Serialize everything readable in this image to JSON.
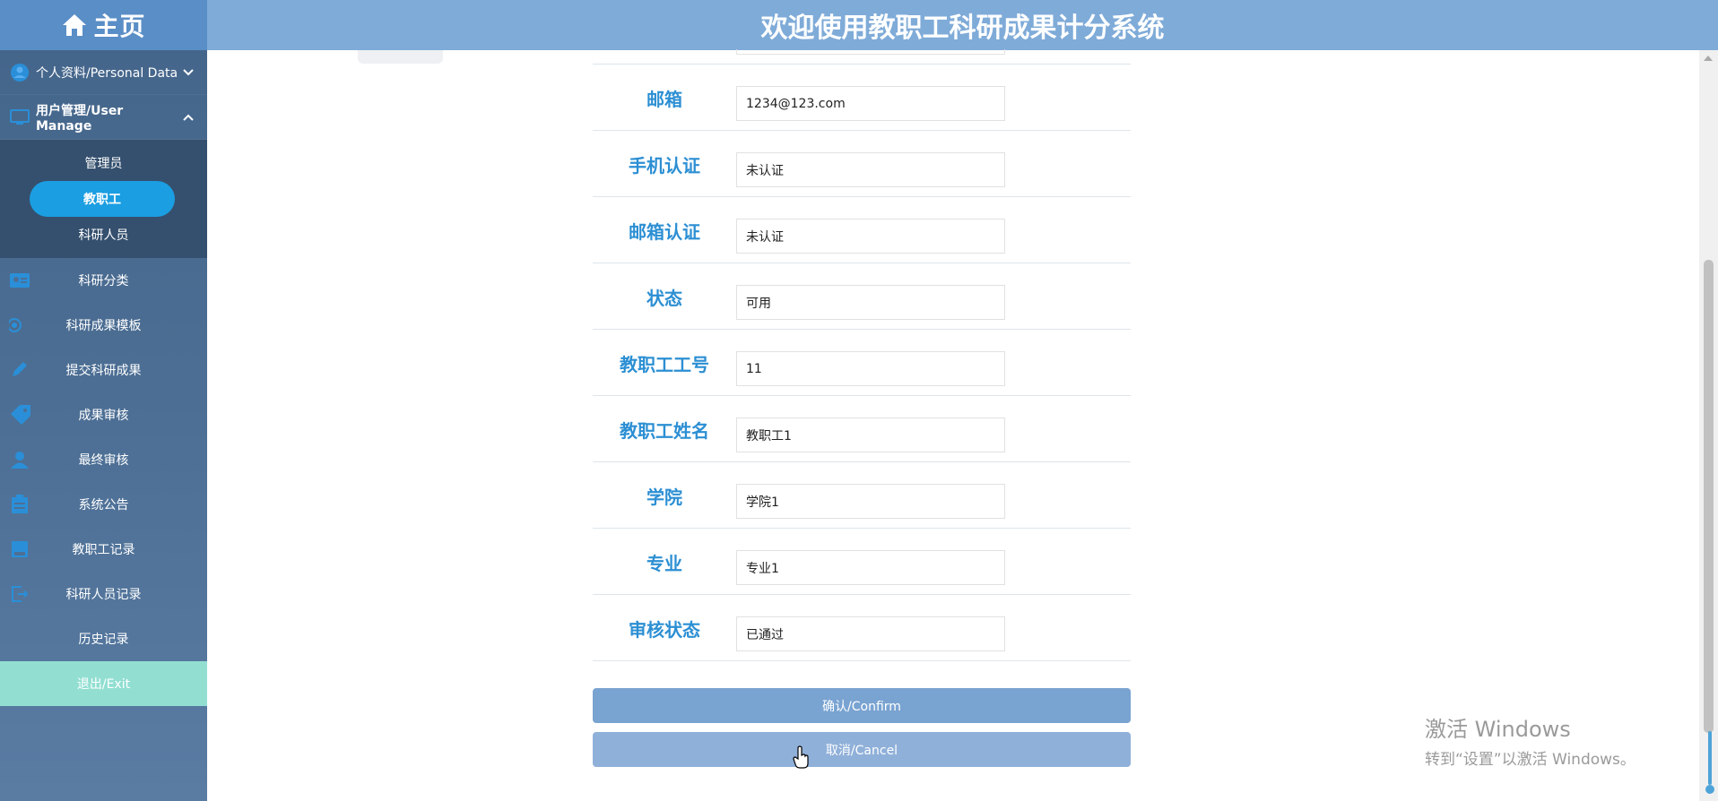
{
  "header": {
    "home_label": "主页",
    "title": "欢迎使用教职工科研成果计分系统"
  },
  "sidebar": {
    "personal_data": "个人资料/Personal Data",
    "user_manage": "用户管理/User Manage",
    "user_manage_items": [
      "管理员",
      "教职工",
      "科研人员"
    ],
    "items": [
      "科研分类",
      "科研成果模板",
      "提交科研成果",
      "成果审核",
      "最终审核",
      "系统公告",
      "教职工记录",
      "科研人员记录",
      "历史记录"
    ],
    "exit": "退出/Exit"
  },
  "form": {
    "fields": [
      {
        "label": "邮箱",
        "value": "1234@123.com"
      },
      {
        "label": "手机认证",
        "value": "未认证"
      },
      {
        "label": "邮箱认证",
        "value": "未认证"
      },
      {
        "label": "状态",
        "value": "可用"
      },
      {
        "label": "教职工工号",
        "value": "11"
      },
      {
        "label": "教职工姓名",
        "value": "教职工1"
      },
      {
        "label": "学院",
        "value": "学院1"
      },
      {
        "label": "专业",
        "value": "专业1"
      },
      {
        "label": "审核状态",
        "value": "已通过"
      }
    ],
    "confirm": "确认/Confirm",
    "cancel": "取消/Cancel"
  },
  "watermark": {
    "line1": "激活 Windows",
    "line2": "转到“设置”以激活 Windows。"
  },
  "colors": {
    "header": "#7fabd8",
    "label": "#2c8fd3",
    "selected": "#1b9ee2",
    "exit": "#92dfd2"
  }
}
